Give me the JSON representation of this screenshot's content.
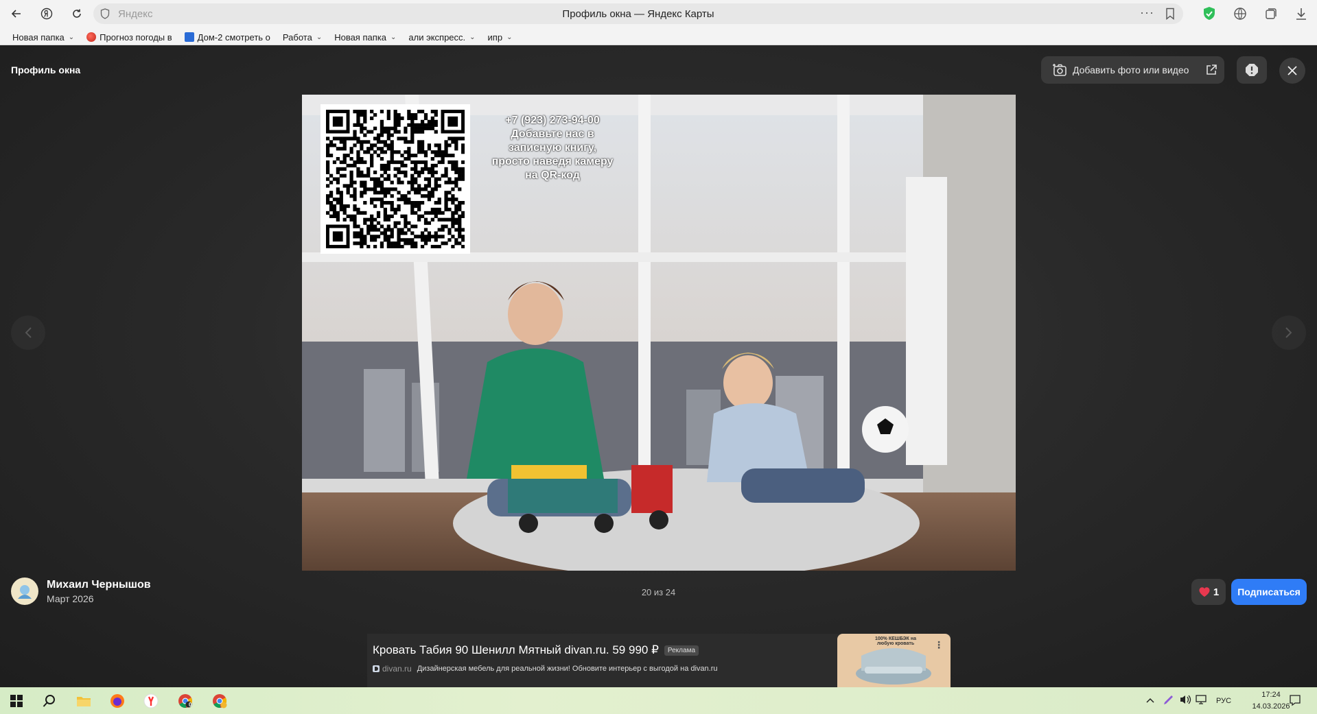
{
  "browser": {
    "address_placeholder": "Яндекс",
    "tab_title": "Профиль окна — Яндекс Карты",
    "bookmarks": [
      {
        "label": "Новая папка",
        "folder": true
      },
      {
        "label": "Прогноз погоды в",
        "folder": false
      },
      {
        "label": "Дом-2 смотреть о",
        "folder": false
      },
      {
        "label": "Работа",
        "folder": true
      },
      {
        "label": "Новая папка",
        "folder": true
      },
      {
        "label": "али экспресс.",
        "folder": true
      },
      {
        "label": "ипр",
        "folder": true
      }
    ]
  },
  "viewer": {
    "page_title": "Профиль окна",
    "add_photo_label": "Добавить фото или видео",
    "qr_caption": [
      "+7 (923) 273-94-00",
      "Добавьте нас в",
      "записную книгу,",
      "просто наведя камеру",
      "на QR-код"
    ],
    "counter": "20 из 24",
    "author": {
      "name": "Михаил Чернышов",
      "date": "Март 2026"
    },
    "likes": "1",
    "subscribe_label": "Подписаться"
  },
  "ad": {
    "title": "Кровать Табия 90 Шенилл Мятный divan.ru. 59 990 ₽",
    "tag": "Реклама",
    "domain": "divan.ru",
    "text": "Дизайнерская мебель для реальной жизни! Обновите интерьер с выгодой на divan.ru",
    "cashback": "100% КЕШБЭК на любую кровать"
  },
  "taskbar": {
    "lang": "РУС",
    "time": "17:24",
    "date": "14.03.2026",
    "chrome_badge": "0"
  },
  "colors": {
    "accent": "#2f7cf6",
    "like_heart": "#e8384f"
  }
}
